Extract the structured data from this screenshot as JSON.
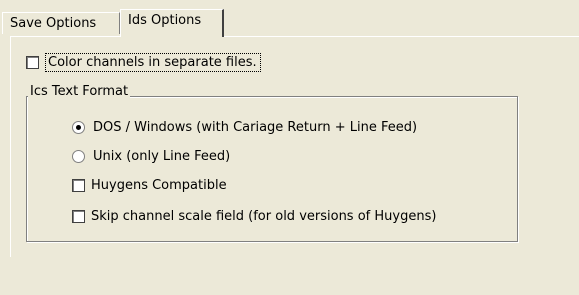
{
  "tabs": [
    {
      "label": "Save Options",
      "active": false
    },
    {
      "label": "Ids Options",
      "active": true
    }
  ],
  "color_channels": {
    "label": "Color channels in separate files.",
    "checked": false
  },
  "ics_text_format": {
    "legend": "Ics Text Format",
    "radios": [
      {
        "label": "DOS / Windows (with Cariage Return + Line Feed)",
        "selected": true
      },
      {
        "label": "Unix (only Line Feed)",
        "selected": false
      }
    ],
    "checkboxes": [
      {
        "label": "Huygens Compatible",
        "checked": false
      },
      {
        "label": "Skip channel scale field (for old versions of Huygens)",
        "checked": false
      }
    ]
  }
}
